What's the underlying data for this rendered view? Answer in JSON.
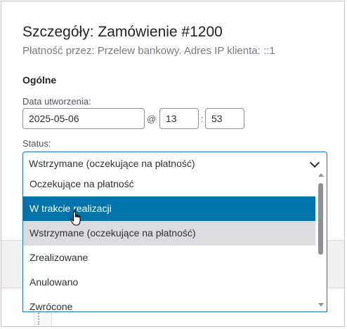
{
  "panel": {
    "title": "Szczegóły: Zamówienie #1200",
    "subtitle": "Płatność przez: Przelew bankowy. Adres IP klienta: ::1"
  },
  "general": {
    "heading": "Ogólne",
    "date_label": "Data utworzenia:",
    "date_value": "2025-05-06",
    "at_sep": "@",
    "hour_value": "13",
    "colon_sep": ":",
    "minute_value": "53",
    "status_label": "Status:",
    "status_value": "Wstrzymane (oczekujące na płatność)"
  },
  "status_options": [
    {
      "label": "Oczekujące na płatność",
      "state": "normal"
    },
    {
      "label": "W trakcie realizacji",
      "state": "hover"
    },
    {
      "label": "Wstrzymane (oczekujące na płatność)",
      "state": "selected"
    },
    {
      "label": "Zrealizowane",
      "state": "normal"
    },
    {
      "label": "Anulowano",
      "state": "normal"
    },
    {
      "label": "Zwrócone",
      "state": "normal"
    }
  ],
  "icons": {
    "chevron": "chevron-down-icon",
    "cursor": "hand-pointer-icon",
    "scroll_up": "scroll-up-arrow-icon",
    "scroll_down": "scroll-down-arrow-icon"
  },
  "colors": {
    "accent": "#2271b1",
    "highlight": "#0073aa",
    "selected_bg": "#dcdcde"
  }
}
